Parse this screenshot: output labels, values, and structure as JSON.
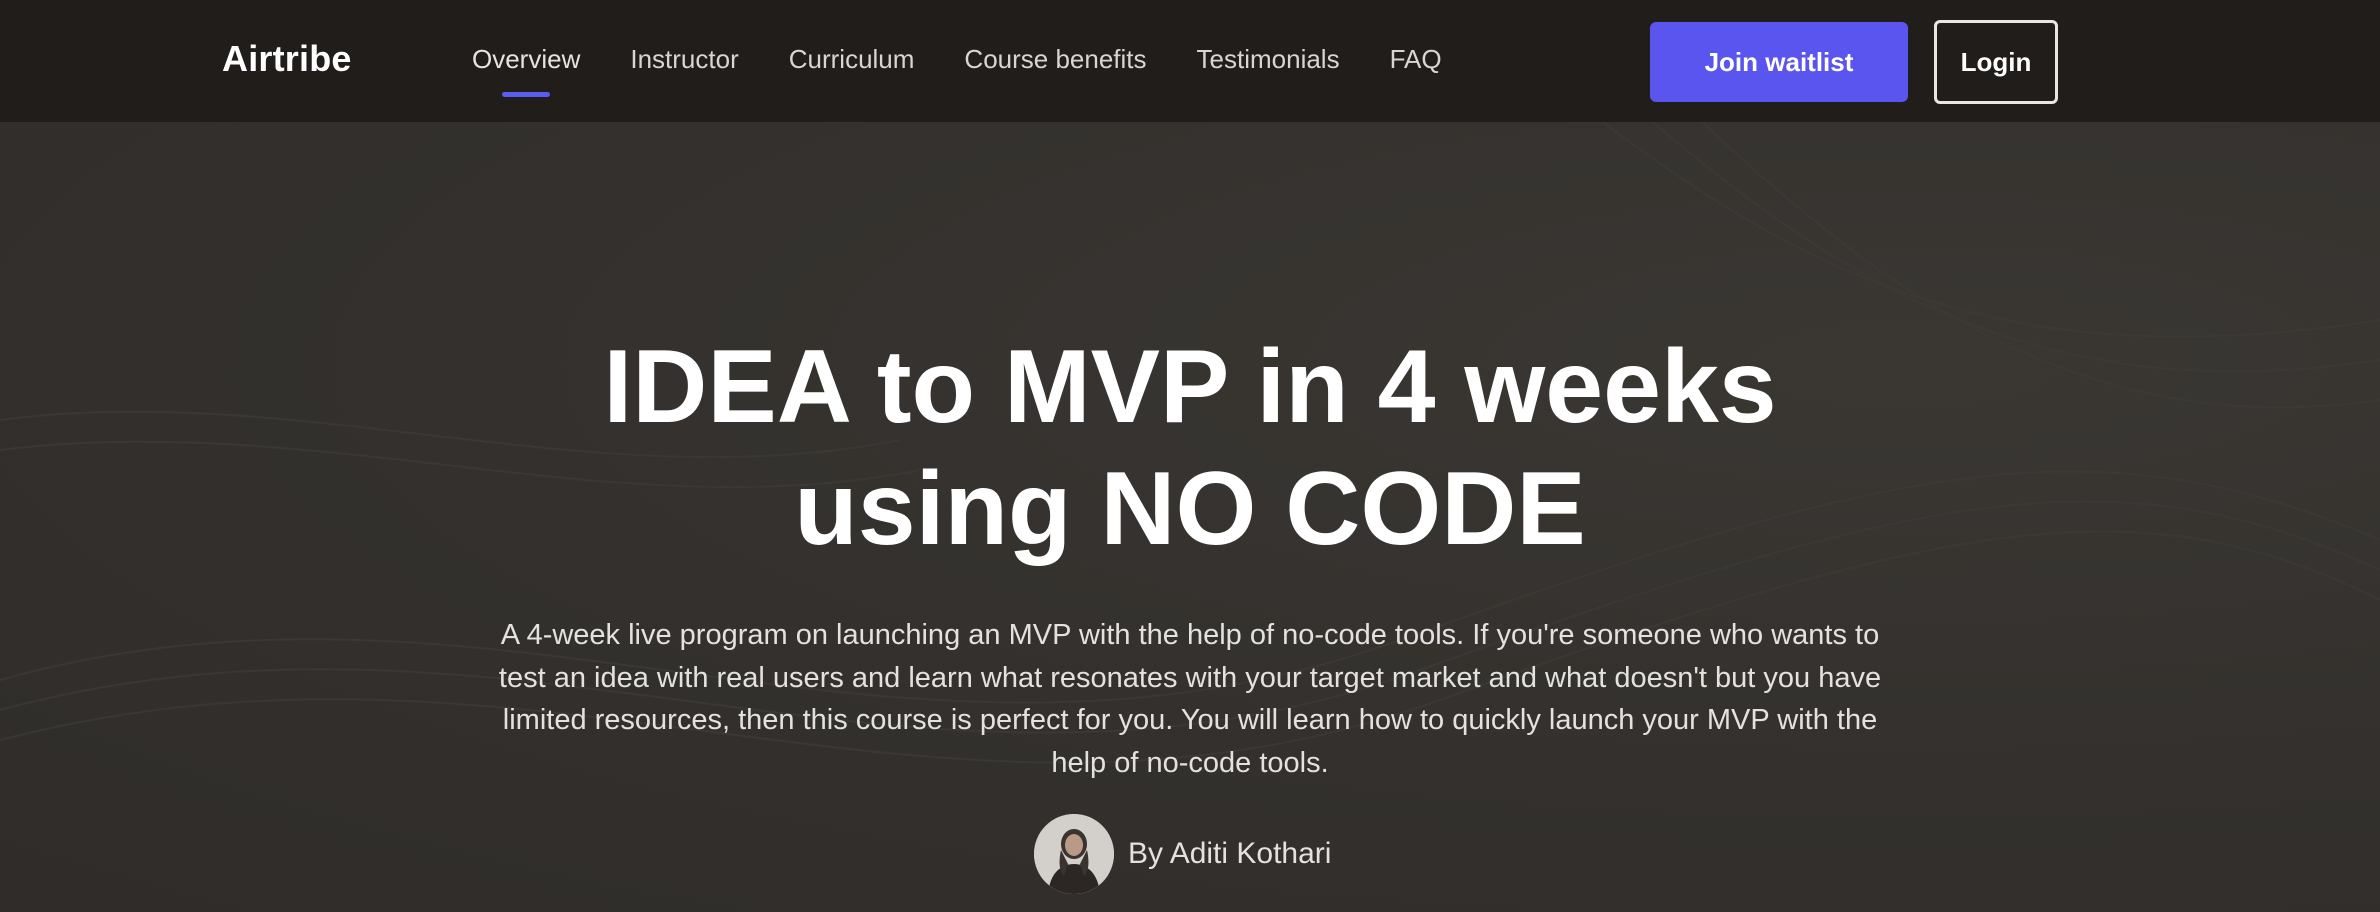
{
  "navbar": {
    "logo": "Airtribe",
    "links": [
      {
        "label": "Overview",
        "active": true
      },
      {
        "label": "Instructor",
        "active": false
      },
      {
        "label": "Curriculum",
        "active": false
      },
      {
        "label": "Course benefits",
        "active": false
      },
      {
        "label": "Testimonials",
        "active": false
      },
      {
        "label": "FAQ",
        "active": false
      }
    ],
    "join_waitlist_label": "Join waitlist",
    "login_label": "Login"
  },
  "hero": {
    "title_line1": "IDEA to MVP in 4 weeks",
    "title_line2": "using NO CODE",
    "description": "A 4-week live program on launching an MVP with the help of no-code tools. If you're someone who wants to test an idea with real users and learn what resonates with your target market and what doesn't but you have limited resources, then this course is perfect for you. You will learn how to quickly launch your MVP with the help of no-code tools.",
    "instructor_text": "By Aditi Kothari",
    "avatar_icon": "instructor-avatar"
  },
  "colors": {
    "navbar_bg": "#201d1b",
    "page_bg": "#34312e",
    "accent": "#5b55ef",
    "text": "#ffffff"
  }
}
